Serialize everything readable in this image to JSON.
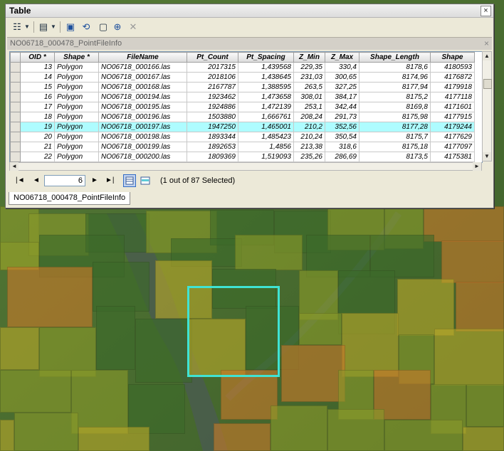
{
  "window": {
    "title": "Table",
    "close_glyph": "×",
    "table_name": "NO06718_000478_PointFileInfo",
    "tab_close_glyph": "×"
  },
  "toolbar": {
    "icons": [
      "table-options-icon",
      "dropdown-icon",
      "related-tables-icon",
      "dropdown-icon",
      "select-by-attributes-icon",
      "switch-selection-icon",
      "clear-selection-icon",
      "zoom-to-selected-icon",
      "delete-selected-icon"
    ]
  },
  "grid": {
    "columns": [
      "OID *",
      "Shape *",
      "FileName",
      "Pt_Count",
      "Pt_Spacing",
      "Z_Min",
      "Z_Max",
      "Shape_Length",
      "Shape"
    ],
    "rows": [
      [
        "13",
        "Polygon",
        "NO06718_000166.las",
        "2017315",
        "1,439568",
        "229,35",
        "330,4",
        "8178,6",
        "4180593"
      ],
      [
        "14",
        "Polygon",
        "NO06718_000167.las",
        "2018106",
        "1,438645",
        "231,03",
        "300,65",
        "8174,96",
        "4176872"
      ],
      [
        "15",
        "Polygon",
        "NO06718_000168.las",
        "2167787",
        "1,388595",
        "263,5",
        "327,25",
        "8177,94",
        "4179918"
      ],
      [
        "16",
        "Polygon",
        "NO06718_000194.las",
        "1923462",
        "1,473658",
        "308,01",
        "384,17",
        "8175,2",
        "4177118"
      ],
      [
        "17",
        "Polygon",
        "NO06718_000195.las",
        "1924886",
        "1,472139",
        "253,1",
        "342,44",
        "8169,8",
        "4171601"
      ],
      [
        "18",
        "Polygon",
        "NO06718_000196.las",
        "1503880",
        "1,666761",
        "208,24",
        "291,73",
        "8175,98",
        "4177915"
      ],
      [
        "19",
        "Polygon",
        "NO06718_000197.las",
        "1947250",
        "1,465001",
        "210,2",
        "352,56",
        "8177,28",
        "4179244"
      ],
      [
        "20",
        "Polygon",
        "NO06718_000198.las",
        "1893344",
        "1,485423",
        "210,24",
        "350,54",
        "8175,7",
        "4177629"
      ],
      [
        "21",
        "Polygon",
        "NO06718_000199.las",
        "1892653",
        "1,4856",
        "213,38",
        "318,6",
        "8175,18",
        "4177097"
      ],
      [
        "22",
        "Polygon",
        "NO06718_000200.las",
        "1809369",
        "1,519093",
        "235,26",
        "286,69",
        "8173,5",
        "4175381"
      ]
    ],
    "selected_oid": "19"
  },
  "scroll": {
    "up": "▲",
    "down": "▼",
    "left": "◄",
    "right": "►"
  },
  "navigation": {
    "first": "|◄",
    "prev": "◄",
    "record_number": "6",
    "next": "►",
    "last": "►|",
    "status": "(1 out of 87 Selected)"
  },
  "map": {
    "selection_color": "#3fe3d3",
    "colors": {
      "green": "#3c6a2a",
      "lime": "#8a9a2a",
      "yellow": "#b8a82a",
      "orange": "#c87a2a",
      "red": "#b8552a"
    }
  }
}
